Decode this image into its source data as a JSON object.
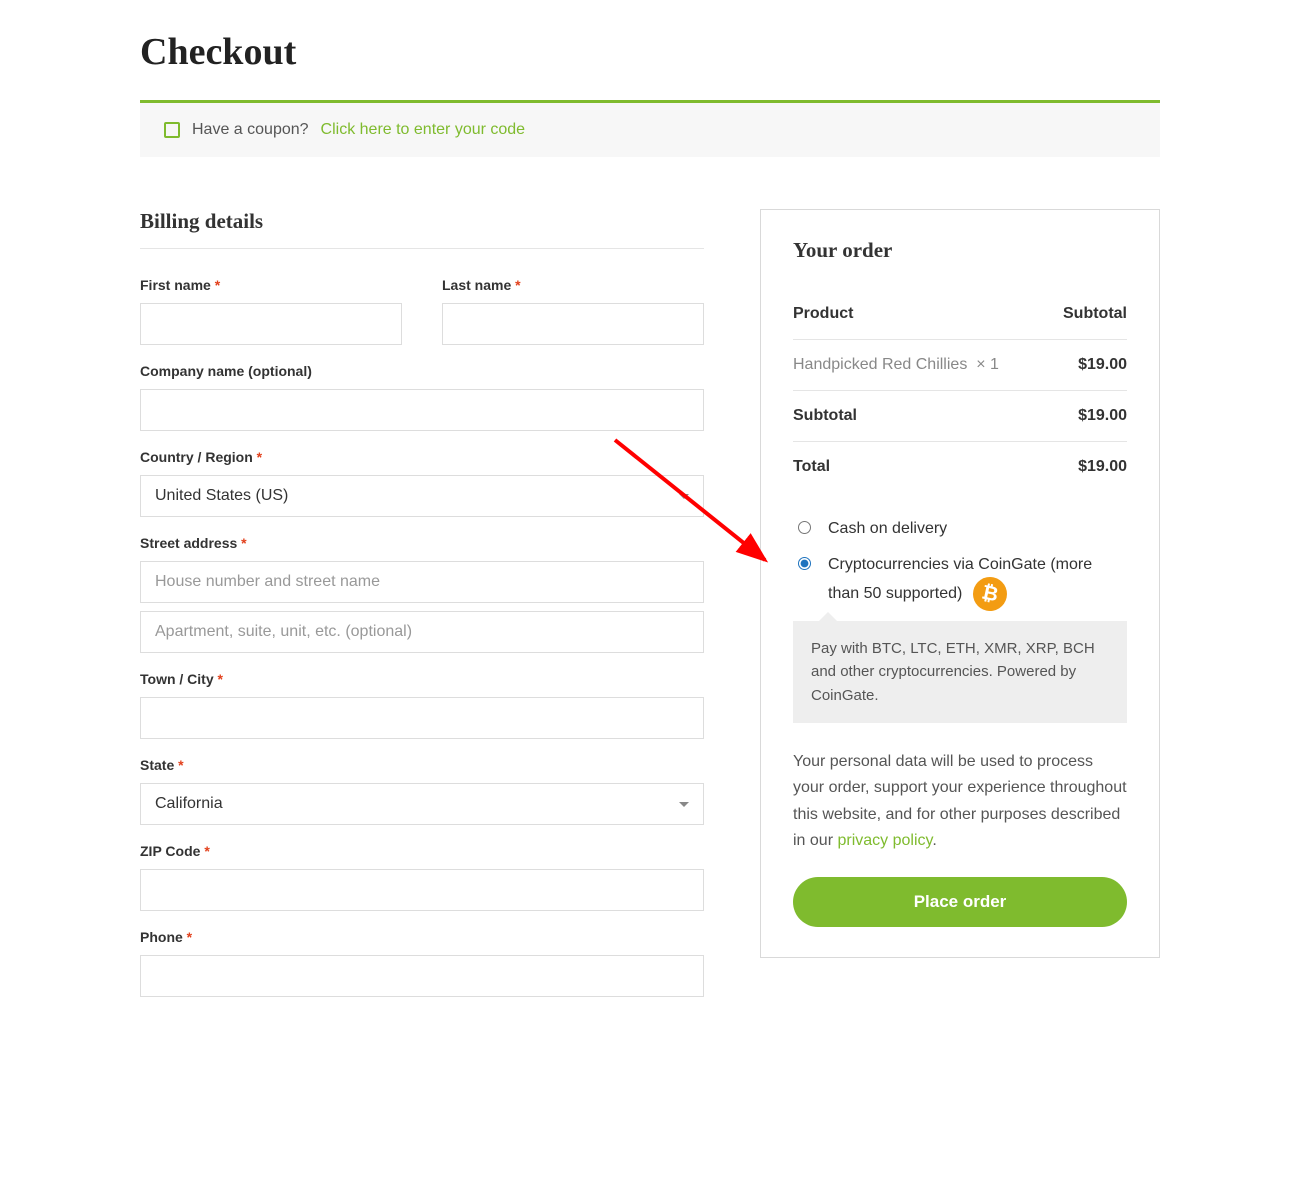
{
  "page": {
    "title": "Checkout"
  },
  "coupon": {
    "prompt": "Have a coupon? ",
    "link": "Click here to enter your code"
  },
  "billing": {
    "heading": "Billing details",
    "first_name_label": "First name",
    "last_name_label": "Last name",
    "company_label": "Company name (optional)",
    "country_label": "Country / Region",
    "country_value": "United States (US)",
    "street_label": "Street address",
    "street_ph1": "House number and street name",
    "street_ph2": "Apartment, suite, unit, etc. (optional)",
    "city_label": "Town / City",
    "state_label": "State",
    "state_value": "California",
    "zip_label": "ZIP Code",
    "phone_label": "Phone",
    "required_mark": "*"
  },
  "order": {
    "heading": "Your order",
    "col_product": "Product",
    "col_subtotal": "Subtotal",
    "items": [
      {
        "name": "Handpicked Red Chillies",
        "qty": "× 1",
        "price": "$19.00"
      }
    ],
    "subtotal_label": "Subtotal",
    "subtotal_value": "$19.00",
    "total_label": "Total",
    "total_value": "$19.00"
  },
  "payment": {
    "cod_label": "Cash on delivery",
    "crypto_label_1": "Cryptocurrencies via CoinGate (more than 50 supported)",
    "crypto_desc": "Pay with BTC, LTC, ETH, XMR, XRP, BCH and other cryptocurrencies. Powered by CoinGate.",
    "selected": "crypto"
  },
  "privacy": {
    "text": "Your personal data will be used to process your order, support your experience throughout this website, and for other purposes described in our ",
    "link": "privacy policy",
    "period": "."
  },
  "buttons": {
    "place_order": "Place order"
  },
  "colors": {
    "accent": "#7fbb2e",
    "bitcoin": "#f39c12",
    "arrow": "#ff0000"
  }
}
